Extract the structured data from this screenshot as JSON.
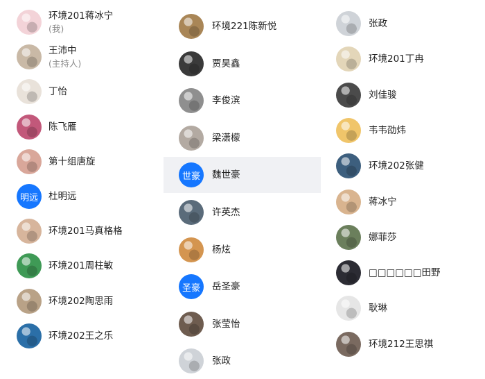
{
  "participants": {
    "column1": [
      {
        "name": "环境201蒋冰宁",
        "role": "(我)",
        "avatar": {
          "type": "photo",
          "color": "#f3d3d8"
        }
      },
      {
        "name": "王沛中",
        "role": "(主持人)",
        "avatar": {
          "type": "photo",
          "color": "#c9b9a6"
        }
      },
      {
        "name": "丁怡",
        "avatar": {
          "type": "photo",
          "color": "#e9e2da"
        }
      },
      {
        "name": "陈飞雁",
        "avatar": {
          "type": "photo",
          "color": "#c2587a"
        }
      },
      {
        "name": "第十组唐旋",
        "avatar": {
          "type": "photo",
          "color": "#d9a79a"
        }
      },
      {
        "name": "杜明远",
        "avatar": {
          "type": "text",
          "text": "明远",
          "color": "#1677ff"
        }
      },
      {
        "name": "环境201马真格格",
        "avatar": {
          "type": "photo",
          "color": "#d7b59c"
        }
      },
      {
        "name": "环境201周柱敏",
        "avatar": {
          "type": "photo",
          "color": "#3f9a56"
        }
      },
      {
        "name": "环境202陶思雨",
        "avatar": {
          "type": "photo",
          "color": "#b9a287"
        }
      },
      {
        "name": "环境202王之乐",
        "avatar": {
          "type": "photo",
          "color": "#2b6fa8"
        }
      }
    ],
    "column2": [
      {
        "name": "环境221陈新悦",
        "avatar": {
          "type": "photo",
          "color": "#a98657"
        }
      },
      {
        "name": "贾昊鑫",
        "avatar": {
          "type": "photo",
          "color": "#3a3a3a"
        }
      },
      {
        "name": "李俊滨",
        "avatar": {
          "type": "photo",
          "color": "#8f8f8f"
        }
      },
      {
        "name": "梁潇檬",
        "avatar": {
          "type": "photo",
          "color": "#b3aaa2"
        }
      },
      {
        "name": "魏世豪",
        "avatar": {
          "type": "text",
          "text": "世豪",
          "color": "#1677ff"
        },
        "selected": true
      },
      {
        "name": "许英杰",
        "avatar": {
          "type": "photo",
          "color": "#5a6b7a"
        }
      },
      {
        "name": "杨炫",
        "avatar": {
          "type": "photo",
          "color": "#d49550"
        }
      },
      {
        "name": "岳圣豪",
        "avatar": {
          "type": "text",
          "text": "圣豪",
          "color": "#1677ff"
        }
      },
      {
        "name": "张莹怡",
        "avatar": {
          "type": "photo",
          "color": "#6e5c4f"
        }
      },
      {
        "name": "张政",
        "avatar": {
          "type": "photo",
          "color": "#cfd3d8"
        }
      }
    ],
    "column3": [
      {
        "name": "张政",
        "avatar": {
          "type": "photo",
          "color": "#cfd3d8"
        }
      },
      {
        "name": "环境201丁冉",
        "avatar": {
          "type": "photo",
          "color": "#e3d6b9"
        }
      },
      {
        "name": "刘佳骏",
        "avatar": {
          "type": "photo",
          "color": "#4b4b4b"
        }
      },
      {
        "name": "韦韦劭炜",
        "avatar": {
          "type": "photo",
          "color": "#f0c56a"
        }
      },
      {
        "name": "环境202张健",
        "avatar": {
          "type": "photo",
          "color": "#3d5f7e"
        }
      },
      {
        "name": "蒋冰宁",
        "avatar": {
          "type": "photo",
          "color": "#d9b48f"
        }
      },
      {
        "name": "娜菲莎",
        "avatar": {
          "type": "photo",
          "color": "#6b7f5c"
        }
      },
      {
        "name": "□□□□□□田野",
        "avatar": {
          "type": "photo",
          "color": "#2c2c34"
        }
      },
      {
        "name": "耿琳",
        "avatar": {
          "type": "photo",
          "color": "#e6e6e6"
        }
      },
      {
        "name": "环境212王思祺",
        "avatar": {
          "type": "photo",
          "color": "#7a6a60"
        }
      }
    ]
  }
}
